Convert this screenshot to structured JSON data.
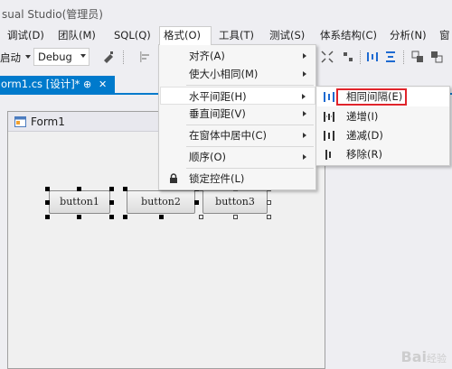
{
  "window": {
    "title": "sual Studio(管理员)"
  },
  "menubar": {
    "items": [
      {
        "label": "调试(D)"
      },
      {
        "label": "团队(M)"
      },
      {
        "label": "SQL(Q)"
      },
      {
        "label": "格式(O)"
      },
      {
        "label": "工具(T)"
      },
      {
        "label": "测试(S)"
      },
      {
        "label": "体系结构(C)"
      },
      {
        "label": "分析(N)"
      },
      {
        "label": "窗"
      }
    ]
  },
  "toolbar": {
    "start_label": "启动",
    "config_value": "Debug"
  },
  "tab": {
    "label": "orm1.cs [设计]*",
    "pin": "⊕",
    "close": "✕"
  },
  "designer": {
    "form_title": "Form1",
    "buttons": [
      {
        "label": "button1"
      },
      {
        "label": "button2"
      },
      {
        "label": "button3"
      }
    ]
  },
  "format_menu": {
    "items": [
      {
        "label": "对齐(A)",
        "has_submenu": true
      },
      {
        "label": "使大小相同(M)",
        "has_submenu": true
      },
      {
        "label": "水平间距(H)",
        "has_submenu": true
      },
      {
        "label": "垂直间距(V)",
        "has_submenu": true
      },
      {
        "label": "在窗体中居中(C)",
        "has_submenu": true
      },
      {
        "label": "顺序(O)",
        "has_submenu": true
      },
      {
        "label": "锁定控件(L)",
        "has_submenu": false
      }
    ]
  },
  "spacing_submenu": {
    "items": [
      {
        "label": "相同间隔(E)"
      },
      {
        "label": "递增(I)"
      },
      {
        "label": "递减(D)"
      },
      {
        "label": "移除(R)"
      }
    ],
    "highlight_color": "#e0242b"
  },
  "watermark": {
    "text": "Bai",
    "suffix": "经验"
  }
}
